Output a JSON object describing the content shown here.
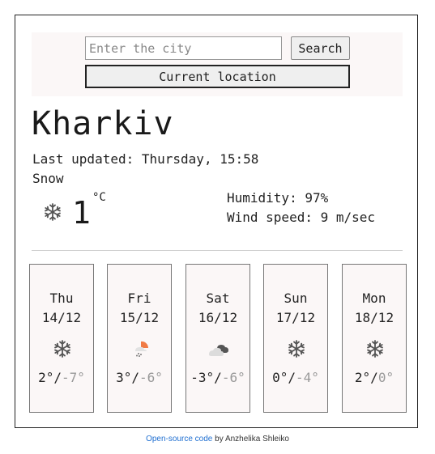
{
  "search": {
    "placeholder": "Enter the city",
    "search_label": "Search",
    "current_location_label": "Current location"
  },
  "current": {
    "city": "Kharkiv",
    "last_updated_label": "Last updated:",
    "last_updated_value": "Thursday, 15:58",
    "description": "Snow",
    "icon": "snowflake-icon",
    "temperature": "1",
    "unit": "°C",
    "humidity_label": "Humidity:",
    "humidity_value": "97%",
    "wind_label": "Wind speed:",
    "wind_value": "9 m/sec"
  },
  "forecast": [
    {
      "day": "Thu",
      "date": "14/12",
      "icon": "snowflake-icon",
      "max": "2°",
      "min": "-7°"
    },
    {
      "day": "Fri",
      "date": "15/12",
      "icon": "sun-snow-cloud-icon",
      "max": "3°",
      "min": "-6°"
    },
    {
      "day": "Sat",
      "date": "16/12",
      "icon": "broken-clouds-icon",
      "max": "-3°",
      "min": "-6°"
    },
    {
      "day": "Sun",
      "date": "17/12",
      "icon": "snowflake-icon",
      "max": "0°",
      "min": "-4°"
    },
    {
      "day": "Mon",
      "date": "18/12",
      "icon": "snowflake-icon",
      "max": "2°",
      "min": "0°"
    }
  ],
  "footer": {
    "link_text": "Open-source code",
    "author_text": "by Anzhelika Shleiko"
  },
  "colors": {
    "panel_bg": "#fbf7f7",
    "min_temp": "#999999",
    "link": "#1f6fd1",
    "sun": "#f07a45"
  }
}
